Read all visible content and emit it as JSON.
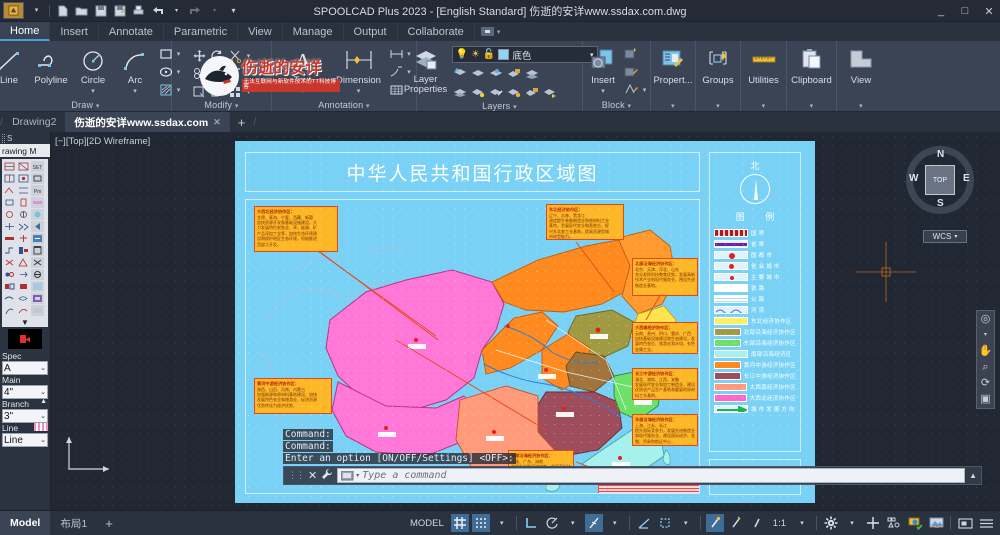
{
  "window": {
    "title": "SPOOLCAD Plus 2023  - [English Standard]    伤逝的安详www.ssdax.com.dwg",
    "minimize": "_",
    "maximize": "□",
    "close": "✕"
  },
  "quick_access": [
    {
      "name": "new-icon",
      "glyph": "🗋"
    },
    {
      "name": "open-icon",
      "glyph": "🗀"
    },
    {
      "name": "save-icon",
      "glyph": "🖫"
    },
    {
      "name": "saveas-icon",
      "glyph": "🖫"
    },
    {
      "name": "plot-icon",
      "glyph": "🖨"
    },
    {
      "name": "undo-icon",
      "glyph": "↩"
    },
    {
      "name": "undo-dropdown-icon",
      "glyph": "▾"
    },
    {
      "name": "redo-icon",
      "glyph": "↪"
    },
    {
      "name": "redo-dropdown-icon",
      "glyph": "▾"
    },
    {
      "name": "qat-customize-icon",
      "glyph": "▾"
    }
  ],
  "ribbon_tabs": [
    {
      "label": "Home",
      "active": true
    },
    {
      "label": "Insert",
      "active": false
    },
    {
      "label": "Annotate",
      "active": false
    },
    {
      "label": "Parametric",
      "active": false
    },
    {
      "label": "View",
      "active": false
    },
    {
      "label": "Manage",
      "active": false
    },
    {
      "label": "Output",
      "active": false
    },
    {
      "label": "Collaborate",
      "active": false
    }
  ],
  "panels": {
    "draw": {
      "title": "Draw",
      "buttons": [
        {
          "label": "Line",
          "icon": "line-icon"
        },
        {
          "label": "Polyline",
          "icon": "polyline-icon"
        },
        {
          "label": "Circle",
          "icon": "circle-icon"
        },
        {
          "label": "Arc",
          "icon": "arc-icon"
        }
      ],
      "small_icons": [
        "rectangle-icon",
        "ellipse-icon",
        "hatch-icon"
      ]
    },
    "modify": {
      "title": "Modify",
      "small_icons": [
        "move-icon",
        "rotate-icon",
        "trim-icon",
        "copy-icon",
        "mirror-icon",
        "fillet-icon",
        "stretch-icon",
        "scale-icon",
        "array-icon"
      ]
    },
    "annotation": {
      "title": "Annotation",
      "buttons": [
        {
          "label": "Text",
          "icon": "text-icon"
        },
        {
          "label": "Dimension",
          "icon": "dimension-icon"
        }
      ],
      "small_icons": [
        "linear-dim-icon",
        "leader-icon",
        "table-icon"
      ]
    },
    "layers": {
      "title": "Layers",
      "layer_properties_label": "Layer\nProperties",
      "current_layer": "底色",
      "layer_color": "#8fd4f0",
      "small_icons": [
        "layer-isolate-icon",
        "layer-freeze-icon",
        "layer-off-icon",
        "layer-lock-icon",
        "layer-merge-icon",
        "layer-match-icon",
        "layer-on-icon",
        "layer-unisolate-icon",
        "layer-thaw-icon",
        "layer-unlock-icon",
        "layer-previous-icon"
      ]
    },
    "block": {
      "title": "Block",
      "buttons": [
        {
          "label": "Insert",
          "icon": "insert-block-icon"
        }
      ],
      "small_icons": [
        "create-block-icon",
        "edit-block-icon",
        "define-attribute-icon"
      ]
    },
    "properties": {
      "title": "",
      "label": "Propert...",
      "icon": "properties-icon"
    },
    "groups": {
      "title": "",
      "label": "Groups",
      "icon": "groups-icon"
    },
    "utilities": {
      "title": "",
      "label": "Utilities",
      "icon": "utilities-icon"
    },
    "clipboard": {
      "title": "",
      "label": "Clipboard",
      "icon": "clipboard-icon"
    },
    "view": {
      "title": "",
      "label": "View",
      "icon": "view-icon"
    }
  },
  "watermark": {
    "main_text": "伤逝的安详",
    "sub_text": "无法互联网与新软件技术的TT科技博客"
  },
  "doc_tabs": [
    {
      "label": "Drawing2",
      "active": false,
      "closable": false
    },
    {
      "label": "伤逝的安详www.ssdax.com",
      "active": true,
      "closable": true
    }
  ],
  "doc_tab_add": "+",
  "left_panel": {
    "title": "rawing M",
    "header_label": "S",
    "fields": [
      {
        "label": "Spec",
        "value": "A"
      },
      {
        "label": "Main",
        "value": "4\""
      },
      {
        "label": "Branch",
        "value": "3\""
      },
      {
        "label": "Line",
        "value": "Line"
      }
    ]
  },
  "viewport": {
    "label": "[−][Top][2D Wireframe]"
  },
  "viewcube": {
    "top": "TOP",
    "north": "N",
    "south": "S",
    "east": "E",
    "west": "W",
    "wcs": "WCS"
  },
  "nav_bar": [
    "full-navigation-wheel-icon",
    "pan-icon",
    "zoom-extents-icon",
    "orbit-icon",
    "showmotion-icon"
  ],
  "drawing": {
    "title": "中华人民共和国行政区域图",
    "legend": {
      "compass_label": "北",
      "title": "图 例",
      "items": [
        {
          "label": "国        界",
          "color": "#b01818",
          "style": "dashed-border"
        },
        {
          "label": "省        界",
          "color": "#6a1fb5",
          "style": "line"
        },
        {
          "label": "国  都  市",
          "color": "#e02020",
          "style": "dot"
        },
        {
          "label": "省 会 城 市",
          "color": "#e02020",
          "style": "dot"
        },
        {
          "label": "主 要 城 市",
          "color": "#e02020",
          "style": "dot-small"
        },
        {
          "label": "铁        路",
          "color": "#ffffff",
          "style": "line"
        },
        {
          "label": "公        路",
          "color": "#d8eef8",
          "style": "line"
        },
        {
          "label": "河        流",
          "color": "#2f7fd0",
          "style": "wave"
        },
        {
          "label": "东北经济协作区",
          "color": "#ffef60"
        },
        {
          "label": "北部沿海经济协作区",
          "color": "#a09a42"
        },
        {
          "label": "东部沿海经济协作区",
          "color": "#6de06a"
        },
        {
          "label": "南部沿海经济区",
          "color": "#a6f0ee"
        },
        {
          "label": "黄河中游经济协作区",
          "color": "#ff8a1f"
        },
        {
          "label": "长江中游经济协作区",
          "color": "#9e4d5c"
        },
        {
          "label": "大西南经济协作区",
          "color": "#ff9b7a"
        },
        {
          "label": "大西北经济协作区",
          "color": "#ff66cc"
        },
        {
          "label": "城 市 发 展 方 向",
          "color": "#22b14c",
          "style": "arrow"
        }
      ]
    },
    "callouts": [
      {
        "heading": "大西北经济协作区：",
        "body": "甘肃、青海、宁夏、西藏、新疆\n加快资源开发和基础设施建设，大\n力发展特色农牧业、草、能源、矿\n产品深加工业等，加快生态环境建\n设和保护地区生态环境，积极推进\n西部大开发。"
      },
      {
        "heading": "东北经济协作区：",
        "body": "辽宁、吉林、黑龙江\n改造提升装备制造业和原材料工业\n基地，发展现代农业和畜牧业，振\n兴东北老工业基地，提高资源型城\n市转型能力。"
      },
      {
        "heading": "北部沿海经济协作区：",
        "body": "北京、天津、河北、山东\n充分发挥科技教育优势，发展高新\n技术产业和现代服务业，建设先进\n制造业基地。"
      },
      {
        "heading": "黄河中游经济协作区：",
        "body": "陕西、山西、河南、内蒙古\n加强能源和原材料基地建设，加快\n发展特色农业和旅游业，促进资源\n优势转化为经济优势。"
      },
      {
        "heading": "大西南经济协作区：",
        "body": "云南、贵州、四川、重庆、广西\n加快基础设施建设和生态建设，发\n展特色农业、旅游业和水电、有色\n金属工业。"
      },
      {
        "heading": "长江中游经济协作区：",
        "body": "湖北、湖南、江西、安徽\n发展现代农业和加工制造业，建设\n优质农产品生产基地和重要的原材\n料工业基地。"
      },
      {
        "heading": "东部沿海经济协作区：",
        "body": "上海、江苏、浙江\n提升国际竞争力，发展先进制造业\n和现代服务业，建设国际经济、金\n融、贸易和航运中心。"
      },
      {
        "heading": "南部沿海经济协作区：",
        "body": "福建、广东、海南\n发挥外向型经济优势，发展高新技\n术产业和现代服务业，加强与港澳\n台经济合作。"
      }
    ]
  },
  "command_line": {
    "history": [
      "Command:",
      "Command:",
      "Enter an option [ON/OFF/Settings] <OFF>:"
    ],
    "placeholder": "Type a command",
    "close_icon": "✕",
    "wrench_icon": "🔧"
  },
  "status_bar": {
    "layout_tabs": [
      {
        "label": "Model",
        "active": true
      },
      {
        "label": "布局1",
        "active": false
      }
    ],
    "layout_add": "+",
    "space_label": "MODEL",
    "scale": "1:1",
    "icons": [
      {
        "name": "grid-display-icon",
        "glyph": "#",
        "on": true
      },
      {
        "name": "snap-mode-icon",
        "glyph": "⣿",
        "on": true
      },
      {
        "name": "snap-dropdown-icon",
        "glyph": "▾",
        "on": false
      },
      {
        "name": "ortho-mode-icon",
        "glyph": "⌐",
        "on": false
      },
      {
        "name": "polar-tracking-icon",
        "glyph": "⦟",
        "on": false
      },
      {
        "name": "polar-dropdown-icon",
        "glyph": "▾",
        "on": false
      },
      {
        "name": "isometric-drafting-icon",
        "glyph": "⟋",
        "on": true
      },
      {
        "name": "isometric-dropdown-icon",
        "glyph": "▾",
        "on": false
      },
      {
        "name": "object-snap-tracking-icon",
        "glyph": "∠",
        "on": false
      },
      {
        "name": "object-snap-icon",
        "glyph": "⬚",
        "on": false
      },
      {
        "name": "osnap-dropdown-icon",
        "glyph": "▾",
        "on": false
      },
      {
        "name": "lineweight-icon",
        "glyph": "⌁",
        "on": true
      },
      {
        "name": "transparency-icon",
        "glyph": "⌁",
        "on": false
      },
      {
        "name": "selection-cycling-icon",
        "glyph": "⌁",
        "on": false
      },
      {
        "name": "annotation-scale-icon",
        "glyph": "⚙",
        "on": false
      },
      {
        "name": "annotation-dropdown-icon",
        "glyph": "▾",
        "on": false
      },
      {
        "name": "add-workspace-icon",
        "glyph": "✛",
        "on": false
      },
      {
        "name": "isolate-objects-icon",
        "glyph": "⧉",
        "on": false
      },
      {
        "name": "hardware-acceleration-icon",
        "glyph": "🖥",
        "on": false
      },
      {
        "name": "clean-screen-icon",
        "glyph": "🖼",
        "on": false
      },
      {
        "name": "fullscreen-icon",
        "glyph": "⛶",
        "on": false
      },
      {
        "name": "customization-icon",
        "glyph": "☰",
        "on": false
      }
    ]
  }
}
